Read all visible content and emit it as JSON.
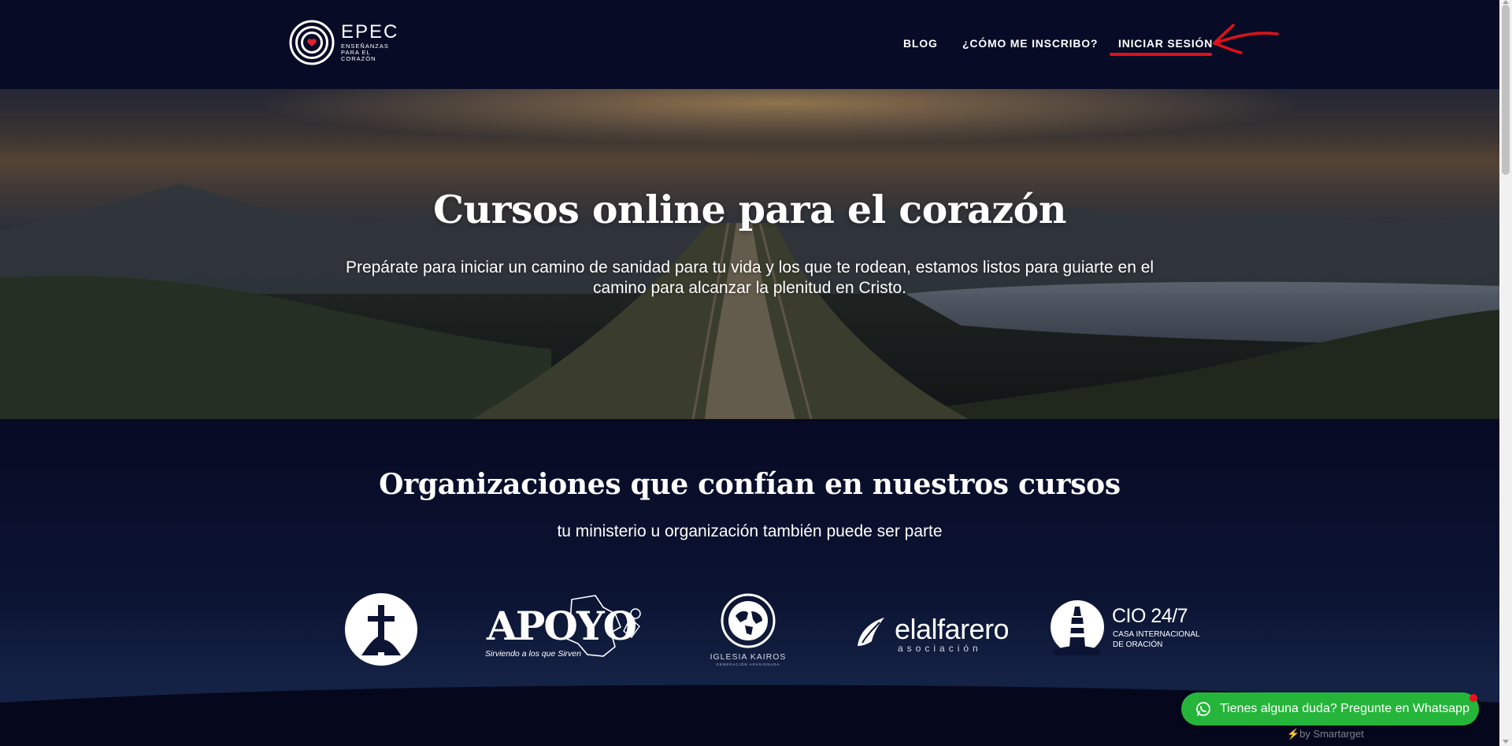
{
  "header": {
    "logo": {
      "brand": "EPEC",
      "tagline": "ENSEÑANZAS PARA EL CORAZÓN"
    },
    "nav": [
      {
        "label": "BLOG"
      },
      {
        "label": "¿CÓMO ME INSCRIBO?"
      },
      {
        "label": "INICIAR SESIÓN",
        "highlighted": true
      }
    ],
    "annotation_color": "#e0111a"
  },
  "hero": {
    "title": "Cursos online para el corazón",
    "subtitle": "Prepárate para iniciar un camino de sanidad para tu vida y los que te rodean, estamos listos para guiarte en el camino para alcanzar la plenitud en Cristo."
  },
  "orgs": {
    "title": "Organizaciones que confían en nuestros cursos",
    "subtitle": "tu ministerio u organización también puede ser parte",
    "logos": [
      {
        "name": "cross-circle-logo"
      },
      {
        "name": "apoyo-logo",
        "text": "APOYO",
        "caption": "Sirviendo a los que Sirven"
      },
      {
        "name": "iglesia-kairos-logo",
        "text": "IGLESIA KAIROS",
        "caption": "GENERACIÓN APASIONADA"
      },
      {
        "name": "elalfarero-logo",
        "text": "elalfarero",
        "caption": "asociación"
      },
      {
        "name": "cio-logo",
        "text": "CIO 24/7",
        "caption1": "CASA INTERNACIONAL",
        "caption2": "DE ORACIÓN"
      }
    ]
  },
  "whatsapp": {
    "label": "Tienes alguna duda? Pregunte en Whatsapp",
    "color": "#25b53a"
  },
  "powered_by": "by Smartarget"
}
